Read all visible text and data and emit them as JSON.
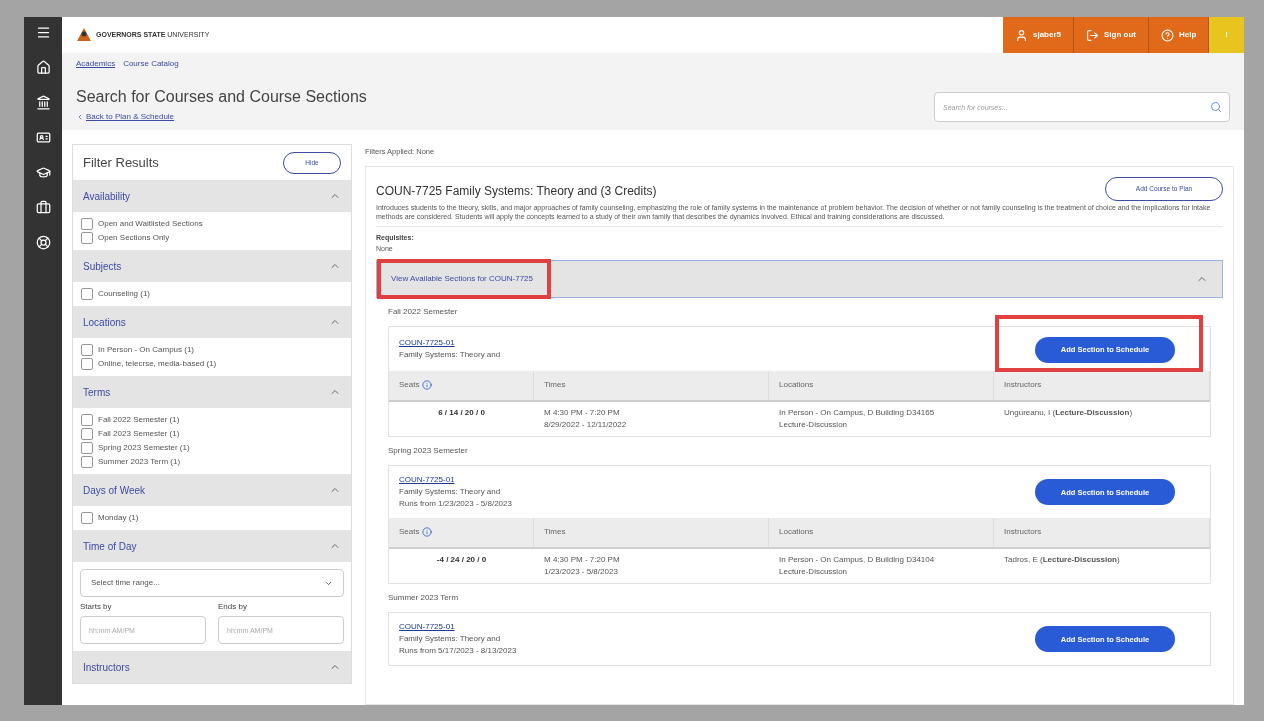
{
  "header": {
    "logo_text": "**GOVERNORS STATE** UNIVERSITY",
    "actions": [
      {
        "kind": "user",
        "label": "sjaber5"
      },
      {
        "kind": "signout",
        "label": "Sign out"
      },
      {
        "kind": "help",
        "label": "Help"
      },
      {
        "kind": "alert",
        "label": "!"
      }
    ]
  },
  "breadcrumbs": [
    {
      "label": "Academics",
      "link": true
    },
    {
      "label": "Course Catalog",
      "link": false
    }
  ],
  "page_title": "Search for Courses and Course Sections",
  "back_link": "Back to Plan & Schedule",
  "search": {
    "placeholder": "Search for courses..."
  },
  "filter_panel": {
    "title": "Filter Results",
    "hide_button": "Hide",
    "groups": [
      {
        "title": "Availability",
        "expanded": true,
        "kind": "checklist",
        "options": [
          {
            "label": "Open and Waitlisted Sections",
            "checked": false
          },
          {
            "label": "Open Sections Only",
            "checked": false
          }
        ]
      },
      {
        "title": "Subjects",
        "expanded": true,
        "kind": "checklist",
        "options": [
          {
            "label": "Counseling (1)",
            "checked": false
          }
        ]
      },
      {
        "title": "Locations",
        "expanded": true,
        "kind": "checklist",
        "options": [
          {
            "label": "In Person - On Campus (1)",
            "checked": false
          },
          {
            "label": "Online, telecrse, media-based (1)",
            "checked": false
          }
        ]
      },
      {
        "title": "Terms",
        "expanded": true,
        "kind": "checklist",
        "options": [
          {
            "label": "Fall 2022 Semester (1)",
            "checked": false
          },
          {
            "label": "Fall 2023 Semester (1)",
            "checked": false
          },
          {
            "label": "Spring 2023 Semester (1)",
            "checked": false
          },
          {
            "label": "Summer 2023 Term (1)",
            "checked": false
          }
        ]
      },
      {
        "title": "Days of Week",
        "expanded": true,
        "kind": "checklist",
        "options": [
          {
            "label": "Monday (1)",
            "checked": false
          }
        ]
      },
      {
        "title": "Time of Day",
        "expanded": true,
        "kind": "time",
        "select_placeholder": "Select time range...",
        "starts_label": "Starts by",
        "ends_label": "Ends by",
        "starts_placeholder": "hh:mm AM/PM",
        "ends_placeholder": "hh:mm AM/PM"
      },
      {
        "title": "Instructors",
        "expanded": true,
        "kind": "checklist"
      }
    ]
  },
  "filters_applied": "Filters Applied: None",
  "course": {
    "title": "COUN-7725 Family Systems: Theory and (3 Credits)",
    "add_button": "Add Course to Plan",
    "description": "Introduces students to the theory, skills, and major approaches of family counseling, emphasizing the role of family systems in the maintenance of problem behavior. The decision of whether or not family counseling is the treatment of choice and the implications for intake methods are considered. Students will apply the concepts learned to a study of their own family that describes the dynamics involved. Ethical and training considerations are discussed.",
    "requisites_label": "Requisites:",
    "requisites": "None",
    "sections_toggle": {
      "label": "View Available Sections for COUN-7725",
      "expanded": true,
      "highlighted": true
    },
    "terms": [
      {
        "name": "Fall 2022 Semester",
        "sections": [
          {
            "code": "COUN-7725-01",
            "title": "Family Systems: Theory and",
            "button": "Add Section to Schedule",
            "highlighted": true,
            "columns": [
              "Seats",
              "Times",
              "Locations",
              "Instructors"
            ],
            "rows": [
              {
                "seats": "6 / 14 / 20 / 0",
                "times": [
                  "M 4:30 PM - 7:20 PM",
                  "8/29/2022 - 12/11/2022"
                ],
                "locations": [
                  "In Person - On Campus, D Building D34165",
                  "Lecture-Discussion"
                ],
                "instructor": "Ungureanu, I (**Lecture-Discussion**)"
              }
            ]
          }
        ]
      },
      {
        "name": "Spring 2023 Semester",
        "sections": [
          {
            "code": "COUN-7725-01",
            "title": "Family Systems: Theory and",
            "runs": "Runs from 1/23/2023 - 5/8/2023",
            "button": "Add Section to Schedule",
            "highlighted": false,
            "columns": [
              "Seats",
              "Times",
              "Locations",
              "Instructors"
            ],
            "rows": [
              {
                "seats": "-4 / 24 / 20 / 0",
                "times": [
                  "M 4:30 PM - 7:20 PM",
                  "1/23/2023 - 5/8/2023"
                ],
                "locations": [
                  "In Person - On Campus, D Building D34104",
                  "Lecture-Discussion"
                ],
                "instructor": "Tadros, E (**Lecture-Discussion**)"
              }
            ]
          }
        ]
      },
      {
        "name": "Summer 2023 Term",
        "sections": [
          {
            "code": "COUN-7725-01",
            "title": "Family Systems: Theory and",
            "runs": "Runs from 5/17/2023 - 8/13/2023",
            "button": "Add Section to Schedule",
            "highlighted": false
          }
        ]
      }
    ]
  }
}
